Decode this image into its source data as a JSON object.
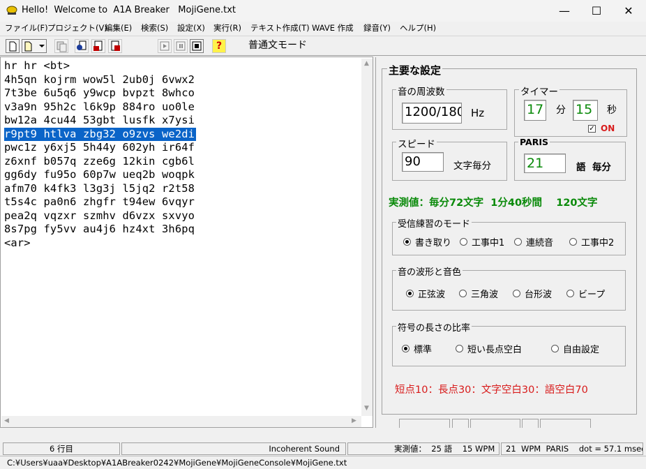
{
  "window": {
    "title": "Hello!  Welcome to  A1A Breaker   MojiGene.txt",
    "minimize": "—",
    "maximize": "☐",
    "close": "✕"
  },
  "menu": [
    "ファイル(F)",
    "プロジェクト(V)",
    "編集(E)",
    "検索(S)",
    "設定(X)",
    "実行(R)",
    "テキスト作成(T)",
    "WAVE 作成",
    "録音(Y)",
    "ヘルプ(H)"
  ],
  "toolbar": {
    "mode_label": "普通文モード",
    "help_glyph": "?"
  },
  "editor": {
    "lines": [
      "hr hr <bt>",
      "4h5qn kojrm wow5l 2ub0j 6vwx2",
      "7t3be 6u5q6 y9wcp bvpzt 8whco",
      "v3a9n 95h2c l6k9p 884ro uo0le",
      "bw12a 4cu44 53gbt lusfk x7ysi",
      "r9pt9 htlva zbg32 o9zvs we2di",
      "pwc1z y6xj5 5h44y 602yh ir64f",
      "z6xnf b057q zze6g 12kin cgb6l",
      "gg6dy fu95o 60p7w ueq2b woqpk",
      "afm70 k4fk3 l3g3j l5jq2 r2t58",
      "t5s4c pa0n6 zhgfr t94ew 6vqyr",
      "pea2q vqzxr szmhv d6vzx sxvyo",
      "8s7pg fy5vv au4j6 hz4xt 3h6pq",
      "<ar>"
    ],
    "selected_line_index": 5
  },
  "settings": {
    "title": "主要な設定",
    "frequency": {
      "label": "音の周波数",
      "value": "1200/180",
      "unit": "Hz"
    },
    "timer": {
      "label": "タイマー",
      "minutes": "17",
      "min_unit": "分",
      "seconds": "15",
      "sec_unit": "秒",
      "on_label": "ON",
      "checked": true
    },
    "speed": {
      "label": "スピード",
      "value": "90",
      "unit": "文字毎分"
    },
    "paris": {
      "label": "PARIS",
      "value": "21",
      "unit": "語  毎分"
    },
    "measured": "実測値：毎分72文字  1分40秒間    120文字",
    "receive_mode": {
      "label": "受信練習のモード",
      "options": [
        "書き取り",
        "工事中1",
        "連続音",
        "工事中2"
      ],
      "selected": 0
    },
    "waveform": {
      "label": "音の波形と音色",
      "options": [
        "正弦波",
        "三角波",
        "台形波",
        "ビープ"
      ],
      "selected": 0
    },
    "ratio": {
      "label": "符号の長さの比率",
      "options": [
        "標準",
        "短い長点空白",
        "自由設定"
      ],
      "selected": 0,
      "text": "短点10：長点30：文字空白30：語空白70"
    }
  },
  "status": {
    "line": "6 行目",
    "sound": "Incoherent Sound",
    "measured": "実測値：  25 語    15 WPM",
    "paris": "21  WPM  PARIS    dot = 57.1 msec",
    "path": "C:¥Users¥uaa¥Desktop¥A1ABreaker0242¥MojiGene¥MojiGeneConsole¥MojiGene.txt"
  }
}
